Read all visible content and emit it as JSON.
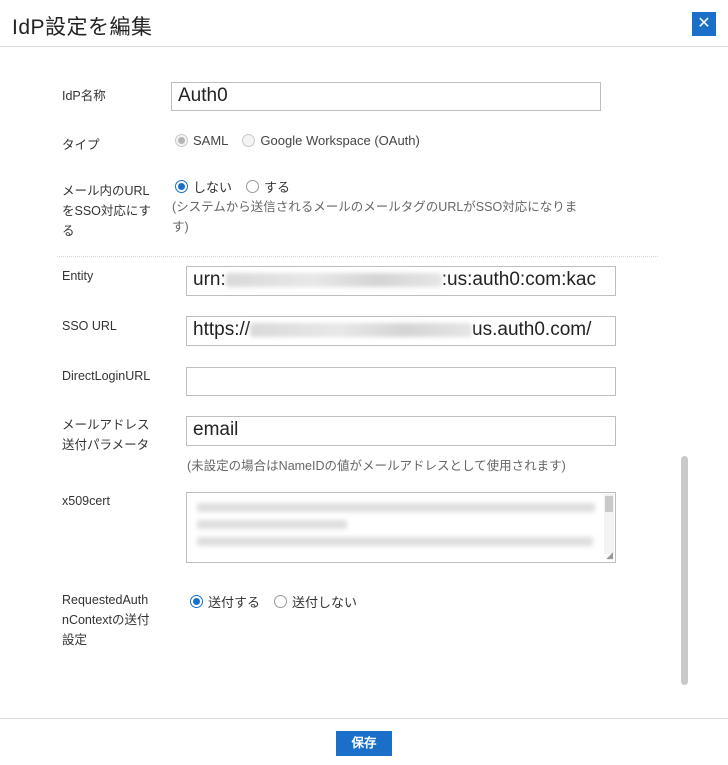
{
  "dialog": {
    "title": "IdP設定を編集",
    "close_icon": "close-icon",
    "close_glyph": "✕",
    "accent_color": "#1a6fc9"
  },
  "form": {
    "idp_name": {
      "label": "IdP名称",
      "value": "Auth0"
    },
    "type": {
      "label": "タイプ",
      "options": [
        "SAML",
        "Google Workspace (OAuth)"
      ],
      "selected": "SAML",
      "disabled": true
    },
    "mail_sso": {
      "label_line1": "メール内のURL",
      "label_line2": "をSSO対応にす",
      "label_line3": "る",
      "options": [
        "しない",
        "する"
      ],
      "selected": "しない",
      "hint_line1": "(システムから送信されるメールのメールタグのURLがSSO対応になりま",
      "hint_line2": "す)"
    },
    "entity": {
      "label": "Entity",
      "prefix": "urn:",
      "suffix": ":us:auth0:com:kac"
    },
    "sso_url": {
      "label": "SSO URL",
      "prefix": "https://",
      "suffix": "us.auth0.com/"
    },
    "direct_login_url": {
      "label": "DirectLoginURL",
      "value": ""
    },
    "email_param": {
      "label_line1": "メールアドレス",
      "label_line2": "送付パラメータ",
      "value": "email",
      "hint": "(未設定の場合はNameIDの値がメールアドレスとして使用されます)"
    },
    "x509cert": {
      "label": "x509cert"
    },
    "requested_authn_context": {
      "label_line1": "RequestedAuth",
      "label_line2": "nContextの送付",
      "label_line3": "設定",
      "options": [
        "送付する",
        "送付しない"
      ],
      "selected": "送付する"
    }
  },
  "footer": {
    "save_label": "保存"
  }
}
